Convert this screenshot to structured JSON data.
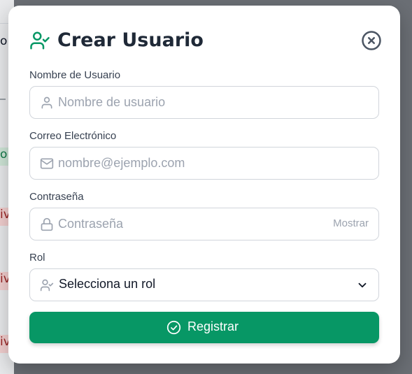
{
  "background": {
    "fragments": [
      "o",
      "o",
      "iv",
      "iv",
      "iv"
    ]
  },
  "modal": {
    "title": "Crear Usuario",
    "close_icon": "close-circle-icon",
    "title_icon": "user-check-icon"
  },
  "form": {
    "username": {
      "label": "Nombre de Usuario",
      "placeholder": "Nombre de usuario",
      "value": "",
      "icon": "user-icon"
    },
    "email": {
      "label": "Correo Electrónico",
      "placeholder": "nombre@ejemplo.com",
      "value": "",
      "icon": "mail-icon"
    },
    "password": {
      "label": "Contraseña",
      "placeholder": "Contraseña",
      "value": "",
      "icon": "lock-icon",
      "toggle_label": "Mostrar"
    },
    "role": {
      "label": "Rol",
      "selected": "Selecciona un rol",
      "icon": "user-check-icon"
    },
    "submit_label": "Registrar",
    "submit_icon": "check-circle-icon"
  },
  "colors": {
    "accent": "#079765",
    "title_text": "#1f2937"
  }
}
